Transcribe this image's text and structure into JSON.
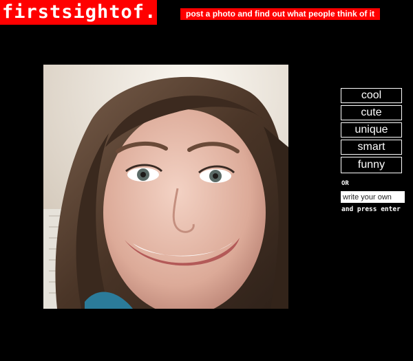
{
  "header": {
    "logo_text": "firstsightof.me",
    "tagline": "post a photo and find out what people think of it"
  },
  "photo": {
    "subject": "selfie-portrait"
  },
  "vote_options": [
    "cool",
    "cute",
    "unique",
    "smart",
    "funny"
  ],
  "custom": {
    "or_label": "OR",
    "placeholder": "write your own",
    "hint": "and press enter"
  },
  "colors": {
    "background": "#000000",
    "accent": "#ff0000",
    "text": "#ffffff"
  }
}
